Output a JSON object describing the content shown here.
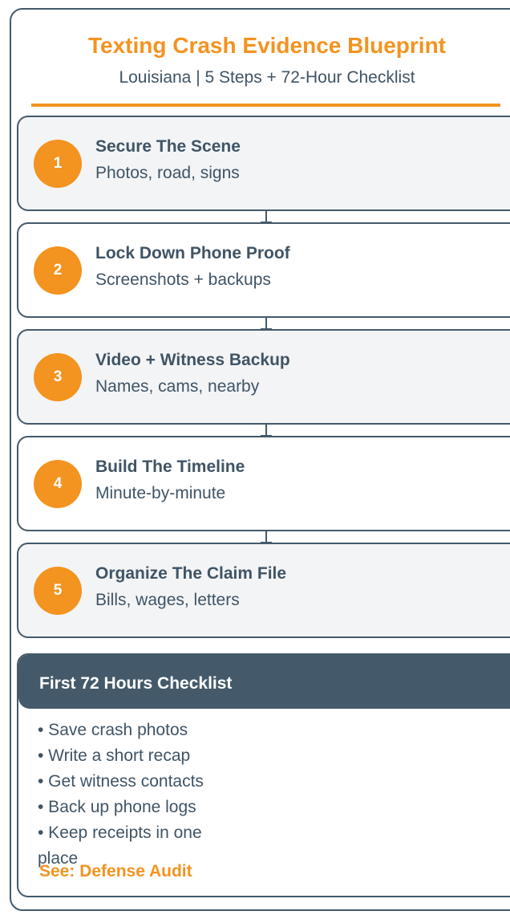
{
  "header": {
    "title": "Texting Crash Evidence Blueprint",
    "subtitle": "Louisiana | 5 Steps + 72-Hour Checklist"
  },
  "steps": [
    {
      "number": "1",
      "title": "Secure The Scene",
      "description": "Photos, road, signs"
    },
    {
      "number": "2",
      "title": "Lock Down Phone Proof",
      "description": "Screenshots + backups"
    },
    {
      "number": "3",
      "title": "Video + Witness Backup",
      "description": "Names, cams, nearby"
    },
    {
      "number": "4",
      "title": "Build The Timeline",
      "description": "Minute-by-minute"
    },
    {
      "number": "5",
      "title": "Organize The Claim File",
      "description": "Bills, wages, letters"
    }
  ],
  "checklist": {
    "title": "First 72 Hours Checklist",
    "items": [
      "• Save crash photos",
      "• Write a short recap",
      "• Get witness contacts",
      "• Back up phone logs",
      "• Keep receipts in one place"
    ],
    "link": "See: Defense Audit"
  },
  "colors": {
    "accent": "#f39320",
    "dark": "#445a6b",
    "text": "#3f5465",
    "step_shaded_bg": "#f2f4f6"
  }
}
